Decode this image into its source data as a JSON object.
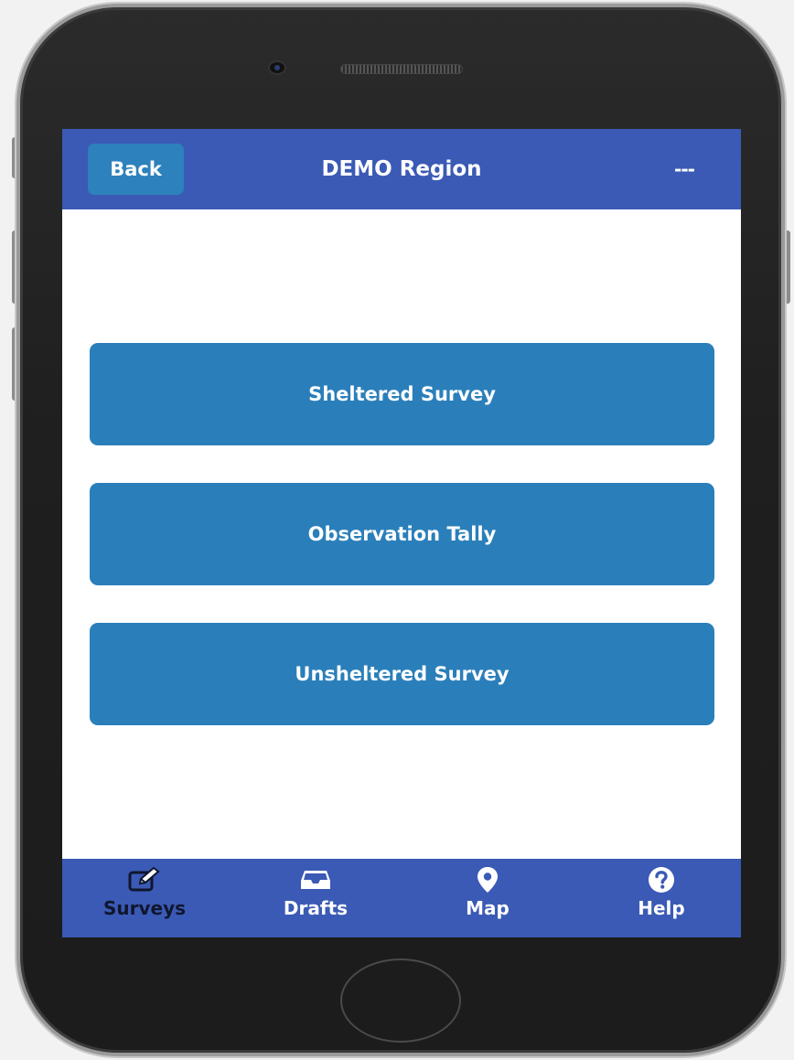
{
  "header": {
    "back_label": "Back",
    "title": "DEMO Region",
    "menu_label": "---"
  },
  "surveys": [
    {
      "label": "Sheltered Survey"
    },
    {
      "label": "Observation Tally"
    },
    {
      "label": "Unsheltered Survey"
    }
  ],
  "tabs": [
    {
      "label": "Surveys",
      "icon": "edit-icon",
      "active": true
    },
    {
      "label": "Drafts",
      "icon": "inbox-icon",
      "active": false
    },
    {
      "label": "Map",
      "icon": "map-marker-icon",
      "active": false
    },
    {
      "label": "Help",
      "icon": "question-circle-icon",
      "active": false
    }
  ],
  "colors": {
    "header_bg": "#3a5ab5",
    "button_bg": "#2a7fba",
    "active_tab_text": "#10162e"
  }
}
